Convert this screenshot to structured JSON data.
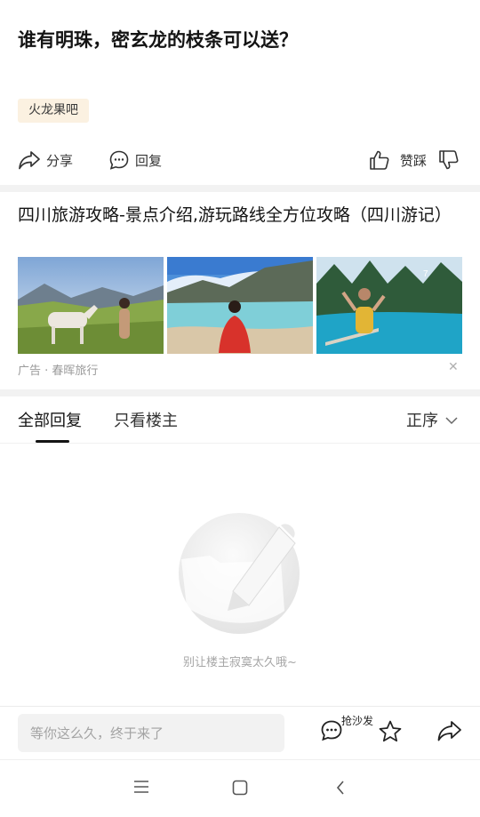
{
  "post": {
    "title": "谁有明珠，密玄龙的枝条可以送？",
    "tag": "火龙果吧"
  },
  "actions": {
    "share_label": "分享",
    "reply_label": "回复",
    "like_label": "赞踩"
  },
  "ad": {
    "title": "四川旅游攻略-景点介绍,游玩路线全方位攻略（四川游记）",
    "meta": "广告 · 春晖旅行",
    "close_glyph": "✕"
  },
  "tabs": {
    "all_label": "全部回复",
    "owner_label": "只看楼主",
    "sort_label": "正序"
  },
  "empty_state": {
    "text": "别让楼主寂寞太久哦~"
  },
  "bottom_bar": {
    "input_placeholder": "等你这么久，终于来了",
    "sofa_label": "抢沙发"
  },
  "icons": {
    "share": "share-icon",
    "reply": "comment-icon",
    "like": "thumb-up-icon",
    "dislike": "thumb-down-icon",
    "sort": "chevron-down-icon",
    "close": "close-icon",
    "star": "star-icon",
    "menu": "menu-icon",
    "home": "home-icon",
    "back": "back-icon"
  }
}
